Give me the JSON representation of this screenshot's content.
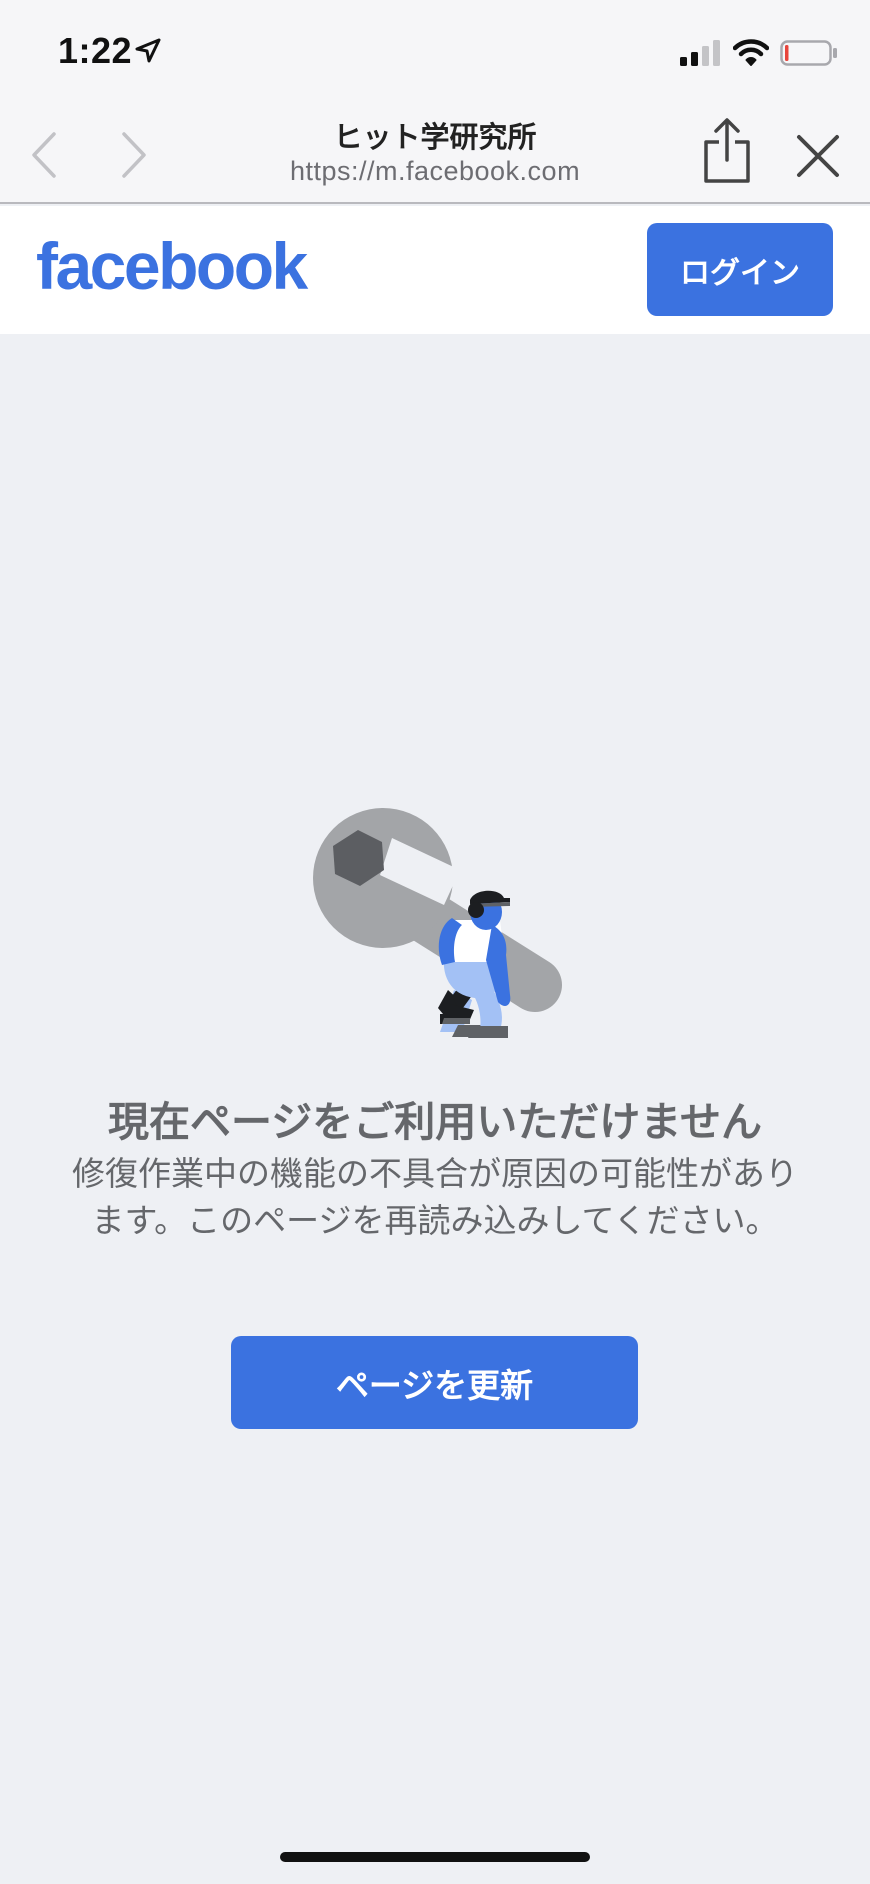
{
  "status_bar": {
    "time": "1:22",
    "icons": [
      "location-arrow-icon",
      "cellular-signal-icon",
      "wifi-icon",
      "battery-icon"
    ]
  },
  "browser": {
    "title": "ヒット学研究所",
    "url": "https://m.facebook.com",
    "icons": [
      "back-chevron-icon",
      "forward-chevron-icon",
      "share-icon",
      "close-icon"
    ]
  },
  "header": {
    "logo": "facebook",
    "login_label": "ログイン"
  },
  "main": {
    "title": "現在ページをご利用いただけません",
    "description": "修復作業中の機能の不具合が原因の可能性があります。このページを再読み込みしてください。",
    "refresh_label": "ページを更新",
    "illustration": "maintenance-wrench-illustration"
  },
  "colors": {
    "brand": "#3b72e0",
    "background": "#eef0f4",
    "text_secondary": "#65676b"
  }
}
